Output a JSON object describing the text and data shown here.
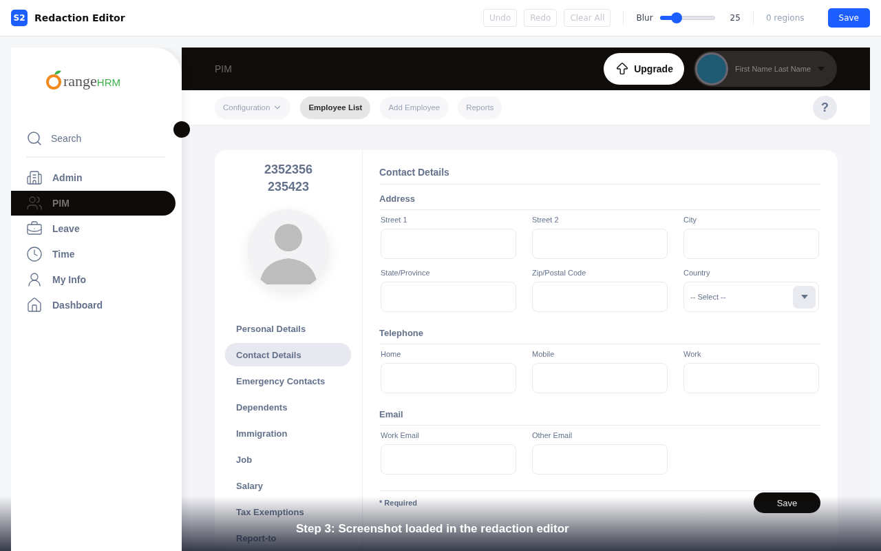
{
  "app": {
    "badge": "S2",
    "title": "Redaction Editor"
  },
  "toolbar": {
    "actions": [
      {
        "label": "Undo",
        "disabled": true
      },
      {
        "label": "Redo",
        "disabled": true
      },
      {
        "label": "Clear All",
        "disabled": true
      }
    ],
    "blur": {
      "label": "Blur",
      "level": 0.25,
      "reading": "25"
    },
    "regions": "0 regions",
    "save": "Save"
  },
  "shot": {
    "logo": {
      "word": "range",
      "suffix": "HRM"
    },
    "sidebar": {
      "search": "Search",
      "items": [
        {
          "label": "Admin",
          "kind": "admin",
          "selected": false
        },
        {
          "label": "PIM",
          "kind": "pim",
          "selected": true
        },
        {
          "label": "Leave",
          "kind": "leave",
          "selected": false
        },
        {
          "label": "Time",
          "kind": "time",
          "selected": false
        },
        {
          "label": "My Info",
          "kind": "info",
          "selected": false
        },
        {
          "label": "Dashboard",
          "kind": "home",
          "selected": false
        }
      ]
    },
    "header": {
      "title": "PIM",
      "upgrade": "Upgrade",
      "user": "First Name Last Name"
    },
    "subnav": [
      {
        "label": "Configuration",
        "dropdown": true,
        "selected": false
      },
      {
        "label": "Employee List",
        "dropdown": false,
        "selected": true
      },
      {
        "label": "Add Employee",
        "dropdown": false,
        "selected": false
      },
      {
        "label": "Reports",
        "dropdown": false,
        "selected": false
      }
    ],
    "help": "?",
    "employee": {
      "name_lines": [
        "2352356",
        "235423"
      ]
    },
    "menu": [
      {
        "label": "Personal Details",
        "selected": false
      },
      {
        "label": "Contact Details",
        "selected": true
      },
      {
        "label": "Emergency Contacts",
        "selected": false
      },
      {
        "label": "Dependents",
        "selected": false
      },
      {
        "label": "Immigration",
        "selected": false
      },
      {
        "label": "Job",
        "selected": false
      },
      {
        "label": "Salary",
        "selected": false
      },
      {
        "label": "Tax Exemptions",
        "selected": false
      },
      {
        "label": "Report-to",
        "selected": false
      }
    ],
    "form": {
      "title": "Contact Details",
      "sections": [
        {
          "title": "Address",
          "fields": [
            {
              "label": "Street 1",
              "kind": "text"
            },
            {
              "label": "Street 2",
              "kind": "text"
            },
            {
              "label": "City",
              "kind": "text"
            },
            {
              "label": "State/Province",
              "kind": "text"
            },
            {
              "label": "Zip/Postal Code",
              "kind": "text"
            },
            {
              "label": "Country",
              "kind": "select",
              "value": "-- Select --"
            }
          ]
        },
        {
          "title": "Telephone",
          "fields": [
            {
              "label": "Home",
              "kind": "text"
            },
            {
              "label": "Mobile",
              "kind": "text"
            },
            {
              "label": "Work",
              "kind": "text"
            }
          ]
        },
        {
          "title": "Email",
          "fields": [
            {
              "label": "Work Email",
              "kind": "text"
            },
            {
              "label": "Other Email",
              "kind": "text"
            }
          ]
        }
      ],
      "required": "* Required",
      "save": "Save"
    }
  },
  "caption": "Step 3: Screenshot loaded in the redaction editor"
}
